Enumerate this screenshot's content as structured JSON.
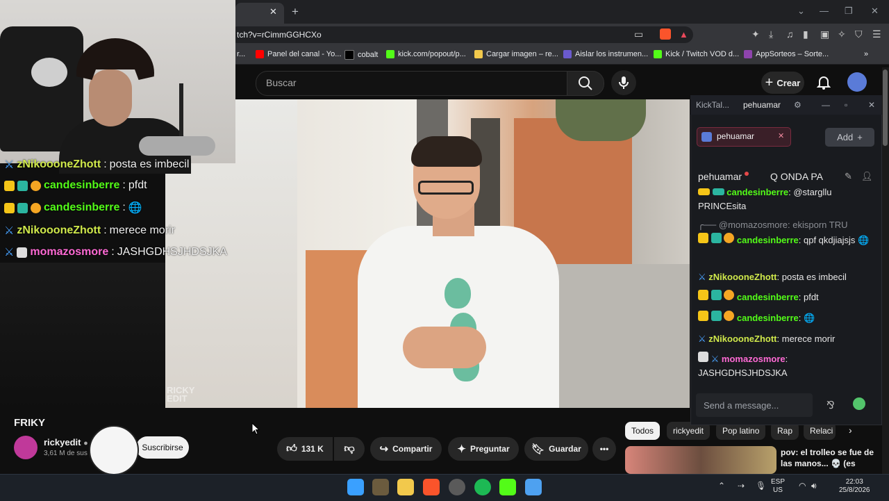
{
  "browser": {
    "url_fragment": "tch?v=rCimmGGHCXo",
    "bookmarks": [
      {
        "label": "Panel del canal - Yo...",
        "icon": "youtube-icon",
        "color": "#ff0000"
      },
      {
        "label": "cobalt",
        "icon": "cobalt-icon",
        "color": "#000000"
      },
      {
        "label": "kick.com/popout/p...",
        "icon": "kick-icon",
        "color": "#53fc18"
      },
      {
        "label": "Cargar imagen – re...",
        "icon": "image-icon",
        "color": "#f2c94c"
      },
      {
        "label": "Aislar los instrumen...",
        "icon": "vocal-icon",
        "color": "#6a5acd"
      },
      {
        "label": "Kick / Twitch VOD d...",
        "icon": "download-icon",
        "color": "#53fc18"
      },
      {
        "label": "AppSorteos – Sorte...",
        "icon": "appsorteos-icon",
        "color": "#8e44ad"
      }
    ],
    "bookmark_prefix": "r..."
  },
  "youtube": {
    "search_placeholder": "Buscar",
    "create_label": "Crear",
    "video_title": "FRIKY",
    "watermark": "RICKY\nEDIT",
    "channel": {
      "name": "rickyedit",
      "subs": "3,61 M de sus"
    },
    "subscribe_label": "Suscribirse",
    "likes": "131 K",
    "share_label": "Compartir",
    "ask_label": "Preguntar",
    "save_label": "Guardar",
    "chips": [
      "Todos",
      "rickyedit",
      "Pop latino",
      "Rap",
      "Relaci"
    ],
    "recommended": {
      "title": "pov: el trolleo se fue de las manos... 💀 (es"
    }
  },
  "overlay_chat": [
    {
      "user": "zNikoooneZhott",
      "message": "posta es imbecil",
      "color": "#d0e94b"
    },
    {
      "user": "candesinberre",
      "message": "pfdt",
      "color": "#53fc18"
    },
    {
      "user": "candesinberre",
      "message": "🌐",
      "color": "#53fc18"
    },
    {
      "user": "zNikoooneZhott",
      "message": "merece morir",
      "color": "#d0e94b"
    },
    {
      "user": "momazosmore",
      "message": "JASHGDHSJHDSJKA",
      "color": "#ff6ad5"
    }
  ],
  "kick_chat": {
    "tabs": [
      "KickTal...",
      "pehuamar"
    ],
    "channel_chip": "pehuamar",
    "add_label": "Add",
    "pinned_user": "pehuamar",
    "pinned_message": "Q ONDA PA",
    "messages": [
      {
        "user": "candesinberre",
        "message": "@stargllu PRINCEsita",
        "color": "#53fc18"
      },
      {
        "reply": "@momazosmore: ekisporn TRU"
      },
      {
        "user": "candesinberre",
        "message": "qpf qkdjiajsjs 🌐",
        "color": "#53fc18"
      },
      {
        "user": "zNikoooneZhott",
        "message": "posta es imbecil",
        "color": "#d0e94b"
      },
      {
        "user": "candesinberre",
        "message": "pfdt",
        "color": "#53fc18"
      },
      {
        "user": "candesinberre",
        "message": "🌐",
        "color": "#53fc18"
      },
      {
        "user": "zNikoooneZhott",
        "message": "merece morir",
        "color": "#d0e94b"
      },
      {
        "user": "momazosmore",
        "message": "JASHGDHSJHDSJKA",
        "color": "#ff6ad5"
      }
    ],
    "input_placeholder": "Send a message..."
  },
  "taskbar": {
    "lang": "ESP\nUS",
    "time": "22:03",
    "date": "25/8/2026"
  }
}
